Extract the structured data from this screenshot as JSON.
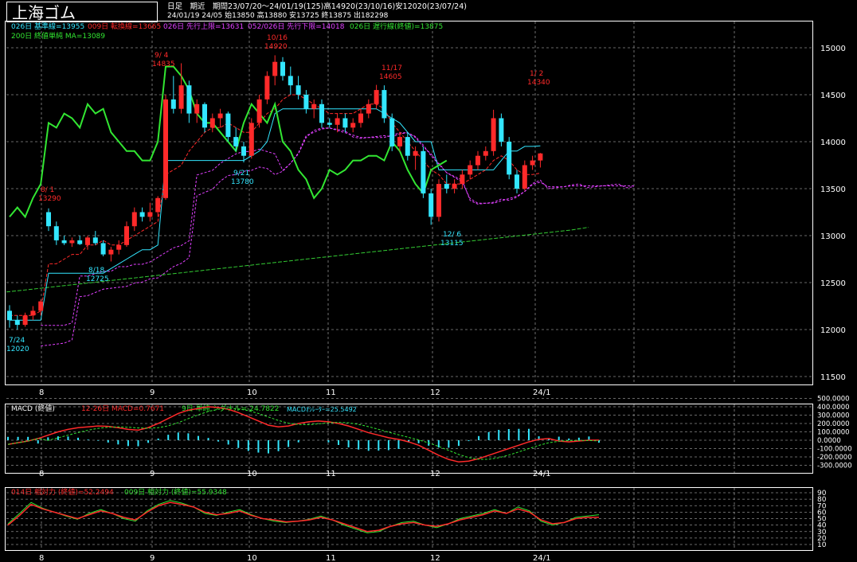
{
  "header": {
    "title": "上海ゴム",
    "info_line1": "日足　期近　期間23/07/20～24/01/19(125)高14920(23/10/16)安12020(23/07/24)",
    "info_line2": "24/01/19 24/05 始13850 高13880 安13725 終13875 出182298"
  },
  "legends": {
    "kijun": "026日 基準線=13955",
    "tenkan": "009日 転換線=13665",
    "senkou1": "026日 先行上限=13631",
    "senkou2": "052/026日 先行下限=14018",
    "chikou": "026日 遅行線(終値)=13875",
    "ma": "200日 終値単純 MA=13089",
    "macd_title": "MACD (終値)",
    "macd": "12-26日 MACD=0.7671",
    "signal": "9日 単純 シグナル=-24.7822",
    "osc": "MACDｵｼﾚｰﾀｰ=25.5492",
    "rsi14": "014日 相対力 (終値)=52.2494",
    "rsi9": "009日 相対力 (終値)=55.9348"
  },
  "colors": {
    "up": "#ff2a2a",
    "down": "#33e6ff",
    "green": "#32e632",
    "kijun": "#33e6ff",
    "tenkan": "#ff2a2a",
    "senkou": "#e040ff",
    "ma": "#33cc33",
    "grid": "#8a8a8a"
  },
  "price_axis": [
    "15000",
    "14500",
    "14000",
    "13500",
    "13000",
    "12500",
    "12000",
    "11500"
  ],
  "macd_axis": [
    "500.0000",
    "400.0000",
    "300.0000",
    "200.0000",
    "100.0000",
    "0.0000",
    "-100.0000",
    "-200.0000",
    "-300.0000"
  ],
  "rsi_axis": [
    "90",
    "80",
    "70",
    "60",
    "50",
    "40",
    "30",
    "20",
    "10"
  ],
  "x_labels": [
    "8",
    "9",
    "10",
    "11",
    "12",
    "24/1"
  ],
  "annotations": [
    {
      "date": "7/24",
      "value": "12020"
    },
    {
      "date": "8/ 1",
      "value": "13290"
    },
    {
      "date": "8/18",
      "value": "12725"
    },
    {
      "date": "9/ 4",
      "value": "14835"
    },
    {
      "date": "9/21",
      "value": "13780"
    },
    {
      "date": "10/16",
      "value": "14920"
    },
    {
      "date": "11/17",
      "value": "14605"
    },
    {
      "date": "12/ 6",
      "value": "13115"
    },
    {
      "date": "1/ 2",
      "value": "14340"
    }
  ],
  "chart_data": {
    "type": "candlestick",
    "ylim": [
      11500,
      15200
    ],
    "candles": [
      [
        12200,
        12260,
        12020,
        12100
      ],
      [
        12100,
        12150,
        12000,
        12050
      ],
      [
        12050,
        12180,
        12030,
        12150
      ],
      [
        12150,
        12250,
        12100,
        12200
      ],
      [
        12200,
        12320,
        12150,
        12300
      ],
      [
        13250,
        13290,
        13050,
        13100
      ],
      [
        13100,
        13150,
        12900,
        12950
      ],
      [
        12950,
        13000,
        12900,
        12920
      ],
      [
        12920,
        12980,
        12880,
        12950
      ],
      [
        12950,
        13000,
        12900,
        12910
      ],
      [
        12900,
        13000,
        12850,
        12980
      ],
      [
        12980,
        13050,
        12900,
        12920
      ],
      [
        12920,
        12950,
        12780,
        12800
      ],
      [
        12800,
        12880,
        12725,
        12850
      ],
      [
        12850,
        12950,
        12800,
        12900
      ],
      [
        12900,
        13150,
        12880,
        13100
      ],
      [
        13100,
        13300,
        13050,
        13250
      ],
      [
        13250,
        13300,
        13150,
        13200
      ],
      [
        13200,
        13350,
        13150,
        13250
      ],
      [
        13250,
        13420,
        13200,
        13400
      ],
      [
        13400,
        14500,
        13380,
        14450
      ],
      [
        14450,
        14700,
        14300,
        14350
      ],
      [
        14350,
        14835,
        14300,
        14600
      ],
      [
        14600,
        14650,
        14200,
        14300
      ],
      [
        14300,
        14450,
        14200,
        14400
      ],
      [
        14400,
        14420,
        14100,
        14150
      ],
      [
        14150,
        14300,
        14100,
        14250
      ],
      [
        14250,
        14350,
        14150,
        14300
      ],
      [
        14300,
        14320,
        14000,
        14050
      ],
      [
        14050,
        14150,
        13900,
        13950
      ],
      [
        13950,
        14000,
        13780,
        13850
      ],
      [
        13850,
        14250,
        13820,
        14200
      ],
      [
        14200,
        14500,
        14150,
        14450
      ],
      [
        14450,
        14750,
        14400,
        14700
      ],
      [
        14700,
        14920,
        14600,
        14850
      ],
      [
        14850,
        14900,
        14650,
        14700
      ],
      [
        14700,
        14800,
        14500,
        14600
      ],
      [
        14600,
        14700,
        14450,
        14500
      ],
      [
        14500,
        14550,
        14300,
        14350
      ],
      [
        14350,
        14450,
        14250,
        14400
      ],
      [
        14400,
        14450,
        14150,
        14200
      ],
      [
        14200,
        14250,
        14150,
        14180
      ],
      [
        14180,
        14300,
        14100,
        14250
      ],
      [
        14250,
        14300,
        14100,
        14150
      ],
      [
        14150,
        14250,
        14100,
        14200
      ],
      [
        14200,
        14350,
        14150,
        14300
      ],
      [
        14300,
        14450,
        14250,
        14400
      ],
      [
        14400,
        14605,
        14350,
        14550
      ],
      [
        14550,
        14600,
        14200,
        14250
      ],
      [
        14250,
        14300,
        13900,
        13950
      ],
      [
        13950,
        14100,
        13900,
        14050
      ],
      [
        14050,
        14100,
        13800,
        13850
      ],
      [
        13850,
        13950,
        13700,
        13900
      ],
      [
        13900,
        13950,
        13400,
        13450
      ],
      [
        13450,
        13500,
        13115,
        13200
      ],
      [
        13200,
        13600,
        13150,
        13550
      ],
      [
        13550,
        13650,
        13450,
        13500
      ],
      [
        13500,
        13600,
        13450,
        13550
      ],
      [
        13550,
        13700,
        13500,
        13650
      ],
      [
        13650,
        13800,
        13600,
        13750
      ],
      [
        13750,
        13900,
        13700,
        13850
      ],
      [
        13850,
        13950,
        13800,
        13900
      ],
      [
        13900,
        14340,
        13850,
        14250
      ],
      [
        14250,
        14300,
        13950,
        14000
      ],
      [
        14000,
        14050,
        13600,
        13650
      ],
      [
        13650,
        13700,
        13450,
        13500
      ],
      [
        13500,
        13800,
        13480,
        13750
      ],
      [
        13750,
        13850,
        13700,
        13800
      ],
      [
        13800,
        13880,
        13725,
        13875
      ]
    ],
    "kijun": [
      12100,
      12100,
      12100,
      12100,
      12100,
      12600,
      12600,
      12600,
      12600,
      12600,
      12600,
      12600,
      12600,
      12650,
      12700,
      12750,
      12800,
      12850,
      12850,
      12900,
      13800,
      13800,
      13800,
      13800,
      13800,
      13800,
      13800,
      13800,
      13800,
      13800,
      13800,
      13850,
      13900,
      14000,
      14300,
      14350,
      14350,
      14350,
      14350,
      14350,
      14350,
      14350,
      14350,
      14350,
      14350,
      14350,
      14350,
      14350,
      14300,
      14250,
      14200,
      14100,
      14000,
      14000,
      14000,
      13700,
      13700,
      13700,
      13700,
      13700,
      13700,
      13700,
      13700,
      13800,
      13900,
      13900,
      13950,
      13950,
      13955
    ],
    "tenkan": [
      12150,
      12150,
      12150,
      12150,
      12200,
      12700,
      12700,
      12750,
      12800,
      12800,
      12900,
      12900,
      12950,
      12900,
      12900,
      12950,
      13000,
      13050,
      13100,
      13150,
      13650,
      13700,
      13750,
      13900,
      14000,
      14100,
      14150,
      14150,
      14200,
      14150,
      14100,
      14100,
      14200,
      14300,
      14350,
      14450,
      14500,
      14500,
      14450,
      14400,
      14350,
      14300,
      14300,
      14300,
      14300,
      14350,
      14400,
      14400,
      14350,
      14200,
      14100,
      14000,
      13900,
      13800,
      13700,
      13650,
      13550,
      13550,
      13550,
      13600,
      13650,
      13700,
      13800,
      13850,
      13800,
      13700,
      13650,
      13650,
      13665
    ],
    "chikou": [
      13200,
      13300,
      13200,
      13400,
      13550,
      14200,
      14150,
      14300,
      14250,
      14150,
      14400,
      14300,
      14350,
      14100,
      14000,
      13900,
      13900,
      13800,
      13800,
      14000,
      14800,
      14800,
      14700,
      14550,
      14300,
      14200,
      14200,
      14100,
      14000,
      13900,
      14200,
      14400,
      14300,
      14200,
      14400,
      14000,
      13900,
      13700,
      13600,
      13400,
      13500,
      13700,
      13650,
      13700,
      13800,
      13800,
      13850,
      13850,
      13800,
      14000,
      13900,
      13700,
      13550,
      13450,
      13700,
      13750,
      13800
    ],
    "ma200": [
      12400,
      12420,
      12440,
      12460,
      12480,
      12500,
      12520,
      12540,
      12560,
      12580,
      12600,
      12620,
      12640,
      12660,
      12680,
      12700,
      12720,
      12740,
      12760,
      12780,
      12800,
      12820,
      12840,
      12860,
      12880,
      12900,
      12920,
      12940,
      12960,
      12980,
      13000,
      13020,
      13040,
      13060,
      13089
    ],
    "macd": [
      -50,
      -30,
      -10,
      20,
      60,
      100,
      130,
      150,
      160,
      170,
      165,
      150,
      130,
      120,
      150,
      200,
      260,
      320,
      360,
      380,
      400,
      390,
      370,
      330,
      280,
      230,
      180,
      160,
      170,
      200,
      220,
      230,
      220,
      200,
      170,
      130,
      90,
      60,
      30,
      10,
      -20,
      -60,
      -120,
      -180,
      -230,
      -260,
      -250,
      -220,
      -180,
      -140,
      -100,
      -60,
      -20,
      10,
      20,
      -10,
      -20,
      -10,
      0,
      1
    ],
    "rsi14": [
      40,
      55,
      72,
      65,
      60,
      55,
      50,
      56,
      62,
      58,
      52,
      48,
      60,
      70,
      75,
      72,
      68,
      60,
      56,
      58,
      62,
      55,
      50,
      48,
      45,
      46,
      48,
      52,
      48,
      42,
      36,
      30,
      32,
      38,
      42,
      44,
      40,
      38,
      42,
      48,
      52,
      56,
      62,
      58,
      65,
      60,
      48,
      42,
      44,
      50,
      52,
      52
    ],
    "rsi9": [
      42,
      58,
      75,
      66,
      60,
      54,
      49,
      58,
      64,
      58,
      50,
      46,
      62,
      72,
      78,
      74,
      68,
      58,
      55,
      60,
      64,
      56,
      50,
      46,
      44,
      46,
      49,
      54,
      48,
      40,
      34,
      28,
      30,
      38,
      44,
      46,
      40,
      36,
      42,
      50,
      54,
      58,
      64,
      58,
      68,
      62,
      46,
      40,
      44,
      52,
      54,
      56
    ]
  }
}
